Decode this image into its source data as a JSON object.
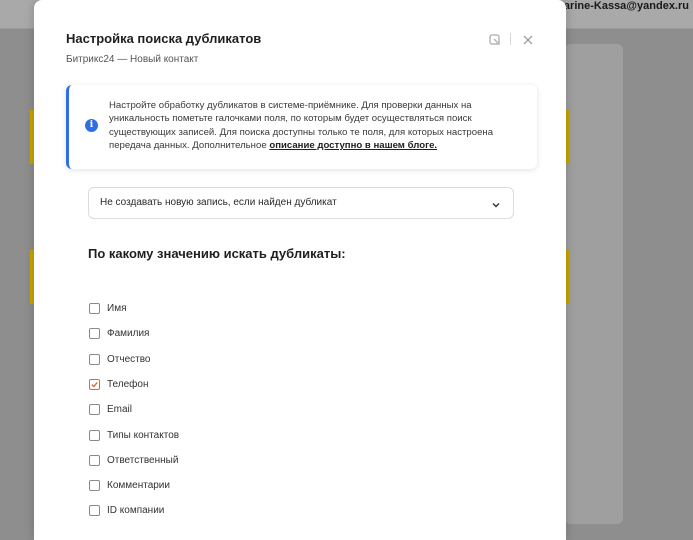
{
  "background": {
    "user_email": "Marine-Kassa@yandex.ru"
  },
  "modal": {
    "title": "Настройка поиска дубликатов",
    "subtitle": "Битрикс24 — Новый контакт",
    "info": {
      "text": "Настройте обработку дубликатов в системе-приёмнике. Для проверки данных на уникальность пометьте галочками поля, по которым будет осуществляться поиск существующих записей. Для поиска доступны только те поля, для которых настроена передача данных. Дополнительное ",
      "link_label": "описание доступно в нашем блоге."
    },
    "duplicate_action": {
      "value": "Не создавать новую запись, если найден дубликат"
    },
    "search_section_title": "По какому значению искать дубликаты:",
    "fields": [
      {
        "label": "Имя",
        "checked": false
      },
      {
        "label": "Фамилия",
        "checked": false
      },
      {
        "label": "Отчество",
        "checked": false
      },
      {
        "label": "Телефон",
        "checked": true
      },
      {
        "label": "Email",
        "checked": false
      },
      {
        "label": "Типы контактов",
        "checked": false
      },
      {
        "label": "Ответственный",
        "checked": false
      },
      {
        "label": "Комментарии",
        "checked": false
      },
      {
        "label": "ID компании",
        "checked": false
      }
    ]
  },
  "colors": {
    "accent": "#2f6fe4",
    "checked": "#e06a2c",
    "overlay": "#8e8e8e"
  }
}
